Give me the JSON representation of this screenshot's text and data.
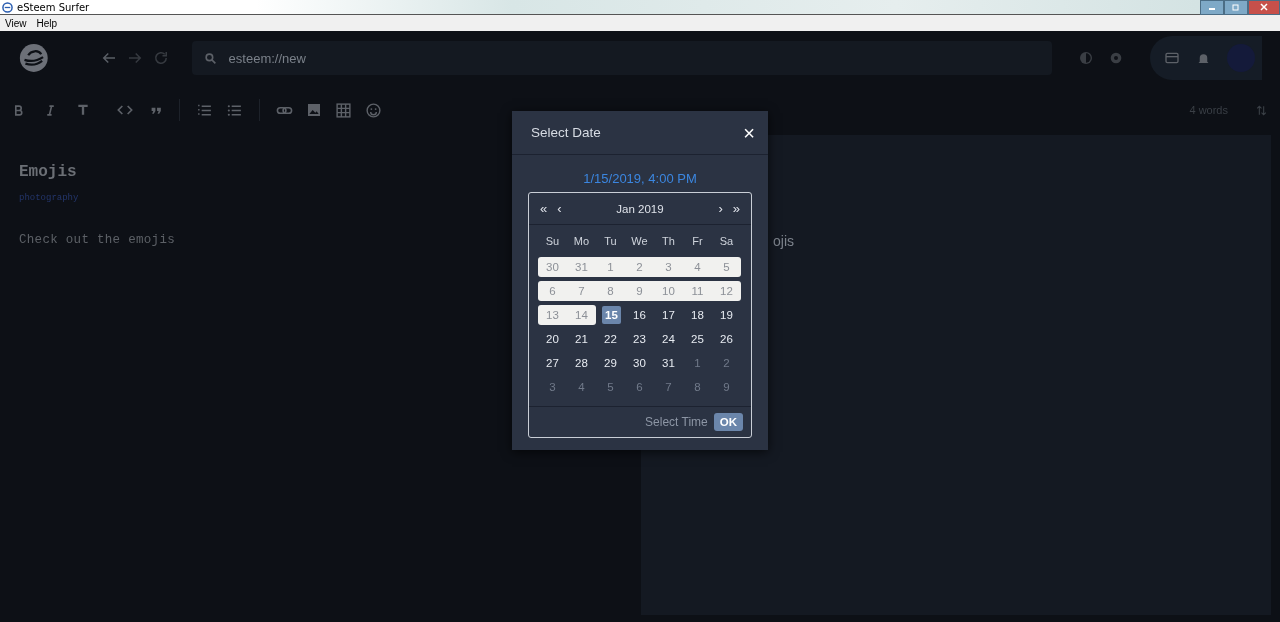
{
  "window": {
    "title": "eSteem Surfer"
  },
  "menu": [
    "View",
    "Help"
  ],
  "address_bar": {
    "value": "esteem://new"
  },
  "editor": {
    "title": "Emojis",
    "tags": "photography",
    "body": "Check out the emojis",
    "word_count": "4 words"
  },
  "preview": {
    "body": "ojis"
  },
  "date_dialog": {
    "title": "Select Date",
    "close": "×",
    "value": "1/15/2019, 4:00 PM",
    "month": "Jan 2019",
    "prev_year": "«",
    "prev_month": "‹",
    "next_month": "›",
    "next_year": "»",
    "weekdays": [
      "Su",
      "Mo",
      "Tu",
      "We",
      "Th",
      "Fr",
      "Sa"
    ],
    "weeks": [
      [
        {
          "day": "30",
          "kind": "disabled",
          "selected": false
        },
        {
          "day": "31",
          "kind": "disabled",
          "selected": false
        },
        {
          "day": "1",
          "kind": "disabled",
          "selected": false
        },
        {
          "day": "2",
          "kind": "disabled",
          "selected": false
        },
        {
          "day": "3",
          "kind": "disabled",
          "selected": false
        },
        {
          "day": "4",
          "kind": "disabled",
          "selected": false
        },
        {
          "day": "5",
          "kind": "disabled",
          "selected": false
        }
      ],
      [
        {
          "day": "6",
          "kind": "disabled",
          "selected": false
        },
        {
          "day": "7",
          "kind": "disabled",
          "selected": false
        },
        {
          "day": "8",
          "kind": "disabled",
          "selected": false
        },
        {
          "day": "9",
          "kind": "disabled",
          "selected": false
        },
        {
          "day": "10",
          "kind": "disabled",
          "selected": false
        },
        {
          "day": "11",
          "kind": "disabled",
          "selected": false
        },
        {
          "day": "12",
          "kind": "disabled",
          "selected": false
        }
      ],
      [
        {
          "day": "13",
          "kind": "disabled",
          "selected": false
        },
        {
          "day": "14",
          "kind": "disabled",
          "selected": false
        },
        {
          "day": "15",
          "kind": "current",
          "selected": true
        },
        {
          "day": "16",
          "kind": "current",
          "selected": false
        },
        {
          "day": "17",
          "kind": "current",
          "selected": false
        },
        {
          "day": "18",
          "kind": "current",
          "selected": false
        },
        {
          "day": "19",
          "kind": "current",
          "selected": false
        }
      ],
      [
        {
          "day": "20",
          "kind": "current",
          "selected": false
        },
        {
          "day": "21",
          "kind": "current",
          "selected": false
        },
        {
          "day": "22",
          "kind": "current",
          "selected": false
        },
        {
          "day": "23",
          "kind": "current",
          "selected": false
        },
        {
          "day": "24",
          "kind": "current",
          "selected": false
        },
        {
          "day": "25",
          "kind": "current",
          "selected": false
        },
        {
          "day": "26",
          "kind": "current",
          "selected": false
        }
      ],
      [
        {
          "day": "27",
          "kind": "current",
          "selected": false
        },
        {
          "day": "28",
          "kind": "current",
          "selected": false
        },
        {
          "day": "29",
          "kind": "current",
          "selected": false
        },
        {
          "day": "30",
          "kind": "current",
          "selected": false
        },
        {
          "day": "31",
          "kind": "current",
          "selected": false
        },
        {
          "day": "1",
          "kind": "outside",
          "selected": false
        },
        {
          "day": "2",
          "kind": "outside",
          "selected": false
        }
      ],
      [
        {
          "day": "3",
          "kind": "outside",
          "selected": false
        },
        {
          "day": "4",
          "kind": "outside",
          "selected": false
        },
        {
          "day": "5",
          "kind": "outside",
          "selected": false
        },
        {
          "day": "6",
          "kind": "outside",
          "selected": false
        },
        {
          "day": "7",
          "kind": "outside",
          "selected": false
        },
        {
          "day": "8",
          "kind": "outside",
          "selected": false
        },
        {
          "day": "9",
          "kind": "outside",
          "selected": false
        }
      ]
    ],
    "select_time": "Select Time",
    "ok": "OK"
  }
}
